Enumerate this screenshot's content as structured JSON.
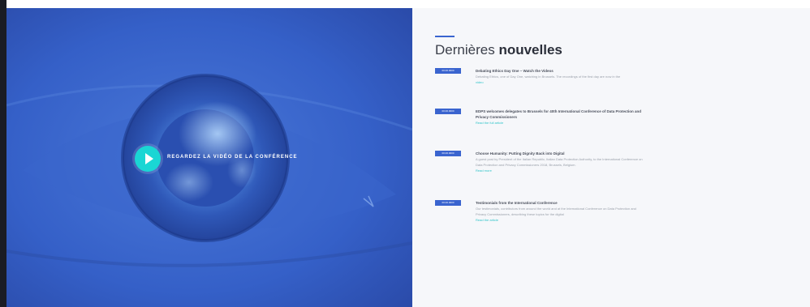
{
  "hero": {
    "play_label": "Regardez la vidéo de la conférence"
  },
  "news": {
    "heading_light": "Dernières",
    "heading_bold": "nouvelles",
    "items": [
      {
        "date": "00.00.0000",
        "title": "Debating Ethics Day One – Watch the Videos",
        "text": "Debating Ethics, one of Day One, watching in Brussels. The recordings of the first day are now in the",
        "link": "video"
      },
      {
        "date": "00.00.0000",
        "title": "EDPS welcomes delegates to Brussels for 40th International Conference of Data Protection and Privacy Commissioners",
        "text": "",
        "link": "Read the full article"
      },
      {
        "date": "00.00.0000",
        "title": "Choose Humanity: Putting Dignity Back into Digital",
        "text": "A guest post by President of the Italian Republic, Italian Data Protection Authority, to the International Conference on Data Protection and Privacy Commissioners 2018, Brussels, Belgium.",
        "link": "Read more"
      },
      {
        "date": "00.00.0000",
        "title": "Testimonials from the International Conference",
        "text": "Our testimonials, contributors from around the world and at the International Conference on Data Protection and Privacy Commissioners, describing these topics for the digital",
        "link": "Read the article"
      }
    ]
  }
}
